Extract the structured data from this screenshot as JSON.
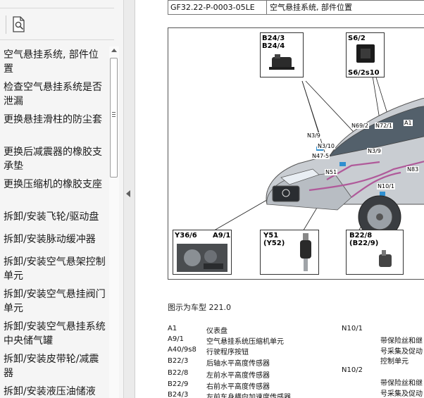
{
  "toc": {
    "items": [
      {
        "label": "空气悬挂系统, 部件位置"
      },
      {
        "label": "检查空气悬挂系统是否泄漏"
      },
      {
        "label": "更换悬挂滑柱的防尘套"
      },
      {
        "label": "更换后减震器的橡胶支承垫"
      },
      {
        "label": "更换压缩机的橡胶支座"
      },
      {
        "label": "拆卸/安装飞轮/驱动盘"
      },
      {
        "label": "拆卸/安装脉动缓冲器"
      },
      {
        "label": "拆卸/安装空气悬架控制单元"
      },
      {
        "label": "拆卸/安装空气悬挂阀门单元"
      },
      {
        "label": "拆卸/安装空气悬挂系统中央储气罐"
      },
      {
        "label": "拆卸/安装皮带轮/减震器"
      },
      {
        "label": "拆卸/安装液压油储液"
      }
    ]
  },
  "document": {
    "header": {
      "code": "GF32.22-P-0003-05LE",
      "title": "空气悬挂系统, 部件位置"
    },
    "figure": {
      "callouts": {
        "b24": {
          "line1": "B24/3",
          "line2": "B24/4"
        },
        "s6": {
          "top": "S6/2",
          "bottom": "S6/2s10"
        },
        "y36": {
          "a": "Y36/6",
          "b": "A9/1"
        },
        "y51": {
          "a": "Y51",
          "b": "(Y52)"
        },
        "b22": {
          "a": "B22/8",
          "b": "(B22/9)"
        }
      },
      "car_labels": {
        "n39": "N3/9",
        "n310": "N3/10",
        "n475": "N47-5",
        "n51": "N51",
        "n692": "N69/2",
        "n721": "N72/1",
        "a1": "A1",
        "n39b": "N3/9",
        "n83": "N83",
        "n101": "N10/1"
      }
    },
    "caption": "图示为车型 221.0",
    "legend_left": [
      {
        "code": "A1",
        "desc": "仪表盘"
      },
      {
        "code": "A9/1",
        "desc": "空气悬挂系统压缩机单元"
      },
      {
        "code": "A40/9s8",
        "desc": "行驶程序按钮"
      },
      {
        "code": "B22/3",
        "desc": "后轴水平高度传感器"
      },
      {
        "code": "B22/8",
        "desc": "左前水平高度传感器"
      },
      {
        "code": "B22/9",
        "desc": "右前水平高度传感器"
      },
      {
        "code": "B24/3",
        "desc": "左前车身横向加速度传感器"
      }
    ],
    "legend_right": [
      {
        "code": "N10/1",
        "desc": [
          "带保险丝和继",
          "号采集及促动",
          "控制单元"
        ]
      },
      {
        "code": "N10/2",
        "desc": [
          "带保险丝和继",
          "号采集及促动"
        ]
      }
    ]
  },
  "colors": {
    "car_body": "#c9cdd2",
    "car_window": "#53606b",
    "pipes": "#b05a9a",
    "sensor": "#2f8fd0"
  }
}
